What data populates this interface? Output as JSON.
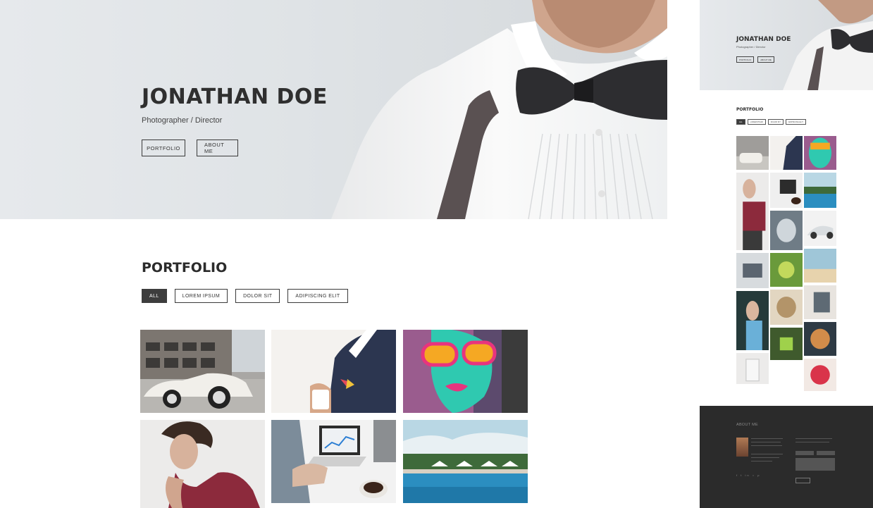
{
  "hero": {
    "name": "JONATHAN DOE",
    "role": "Photographer / Director",
    "buttons": [
      "PORTFOLIO",
      "ABOUT ME"
    ]
  },
  "portfolio": {
    "title": "PORTFOLIO",
    "filters": [
      "ALL",
      "LOREM IPSUM",
      "DOLOR SIT",
      "ADIPISCING ELIT"
    ],
    "active_filter": "ALL"
  },
  "mobile": {
    "hero": {
      "name": "JONATHAN DOE",
      "role": "Photographer / Director",
      "buttons": [
        "PORTFOLIO",
        "ABOUT ME"
      ]
    },
    "portfolio": {
      "title": "PORTFOLIO",
      "filters": [
        "ALL",
        "LOREM IPSUM",
        "DOLOR SIT",
        "ADIPISCING ELIT"
      ]
    },
    "footer": {
      "about_title": "ABOUT ME",
      "social_icons": [
        "facebook-icon",
        "twitter-icon",
        "linkedin-icon",
        "instagram-icon",
        "pinterest-icon"
      ]
    }
  },
  "colors": {
    "dark": "#2b2b2b",
    "active_filter_bg": "#3d3d3d",
    "hero_bg": "#e2e6e9"
  }
}
